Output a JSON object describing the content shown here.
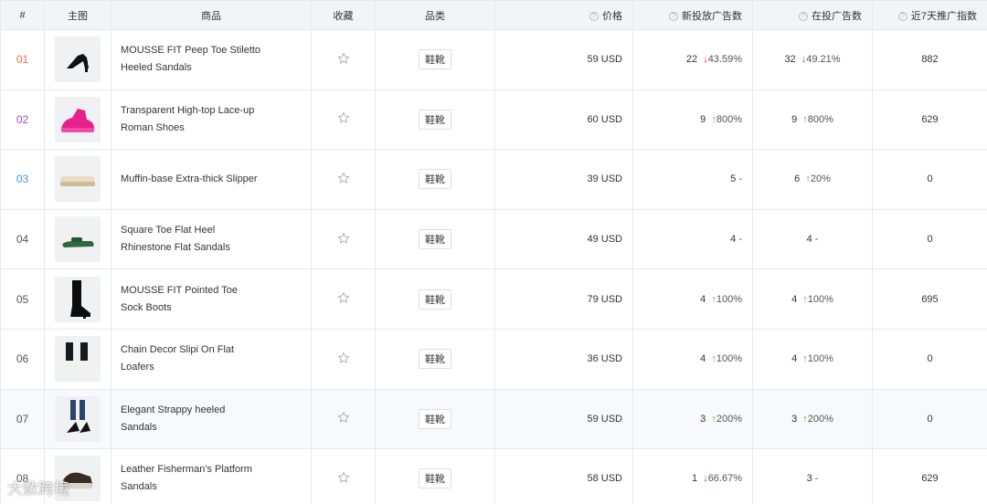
{
  "headers": {
    "rank": "#",
    "image": "主图",
    "product": "商品",
    "favorite": "收藏",
    "category": "品类",
    "price": "价格",
    "new_ads": "新投放广告数",
    "active_ads": "在投广告数",
    "index7d": "近7天推广指数"
  },
  "colors": {
    "accent_rank_1": "#f56c3d",
    "accent_rank_2": "#a24cd9",
    "accent_rank_3": "#3a9ce0",
    "up": "#52c41a",
    "down": "#f5222d"
  },
  "rows": [
    {
      "rank": "01",
      "name_line1": "MOUSSE FIT Peep Toe Stiletto",
      "name_line2": "Heeled Sandals",
      "category": "鞋靴",
      "price": "59 USD",
      "new_ads": "22",
      "new_change": "43.59%",
      "new_dir": "down",
      "active_ads": "32",
      "active_change": "49.21%",
      "active_dir": "down",
      "index7d": "882",
      "thumb": "heel-sandal-icon"
    },
    {
      "rank": "02",
      "name_line1": "Transparent High-top Lace-up",
      "name_line2": "Roman Shoes",
      "category": "鞋靴",
      "price": "60 USD",
      "new_ads": "9",
      "new_change": "800%",
      "new_dir": "up",
      "active_ads": "9",
      "active_change": "800%",
      "active_dir": "up",
      "index7d": "629",
      "thumb": "pink-shoe-icon"
    },
    {
      "rank": "03",
      "name_line1": "Muffin-base Extra-thick Slipper",
      "name_line2": "",
      "category": "鞋靴",
      "price": "39 USD",
      "new_ads": "5",
      "new_change": "-",
      "new_dir": "none",
      "active_ads": "6",
      "active_change": "20%",
      "active_dir": "up",
      "index7d": "0",
      "thumb": "slipper-icon"
    },
    {
      "rank": "04",
      "name_line1": "Square Toe Flat Heel",
      "name_line2": "Rhinestone Flat Sandals",
      "category": "鞋靴",
      "price": "49 USD",
      "new_ads": "4",
      "new_change": "-",
      "new_dir": "none",
      "active_ads": "4",
      "active_change": "-",
      "active_dir": "none",
      "index7d": "0",
      "thumb": "green-sandal-icon"
    },
    {
      "rank": "05",
      "name_line1": "MOUSSE FIT Pointed Toe",
      "name_line2": "Sock Boots",
      "category": "鞋靴",
      "price": "79 USD",
      "new_ads": "4",
      "new_change": "100%",
      "new_dir": "up",
      "active_ads": "4",
      "active_change": "100%",
      "active_dir": "up",
      "index7d": "695",
      "thumb": "sock-boot-icon"
    },
    {
      "rank": "06",
      "name_line1": "Chain Decor Slipi On Flat",
      "name_line2": "Loafers",
      "category": "鞋靴",
      "price": "36 USD",
      "new_ads": "4",
      "new_change": "100%",
      "new_dir": "up",
      "active_ads": "4",
      "active_change": "100%",
      "active_dir": "up",
      "index7d": "0",
      "thumb": "loafer-icon"
    },
    {
      "rank": "07",
      "name_line1": "Elegant Strappy heeled",
      "name_line2": "Sandals",
      "category": "鞋靴",
      "price": "59 USD",
      "new_ads": "3",
      "new_change": "200%",
      "new_dir": "up",
      "active_ads": "3",
      "active_change": "200%",
      "active_dir": "up",
      "index7d": "0",
      "thumb": "strappy-heel-icon"
    },
    {
      "rank": "08",
      "name_line1": "Leather Fisherman's Platform",
      "name_line2": "Sandals",
      "category": "鞋靴",
      "price": "58 USD",
      "new_ads": "1",
      "new_change": "66.67%",
      "new_dir": "down",
      "active_ads": "3",
      "active_change": "-",
      "active_dir": "none",
      "index7d": "629",
      "thumb": "platform-sandal-icon"
    }
  ],
  "watermark": "大数跨境"
}
